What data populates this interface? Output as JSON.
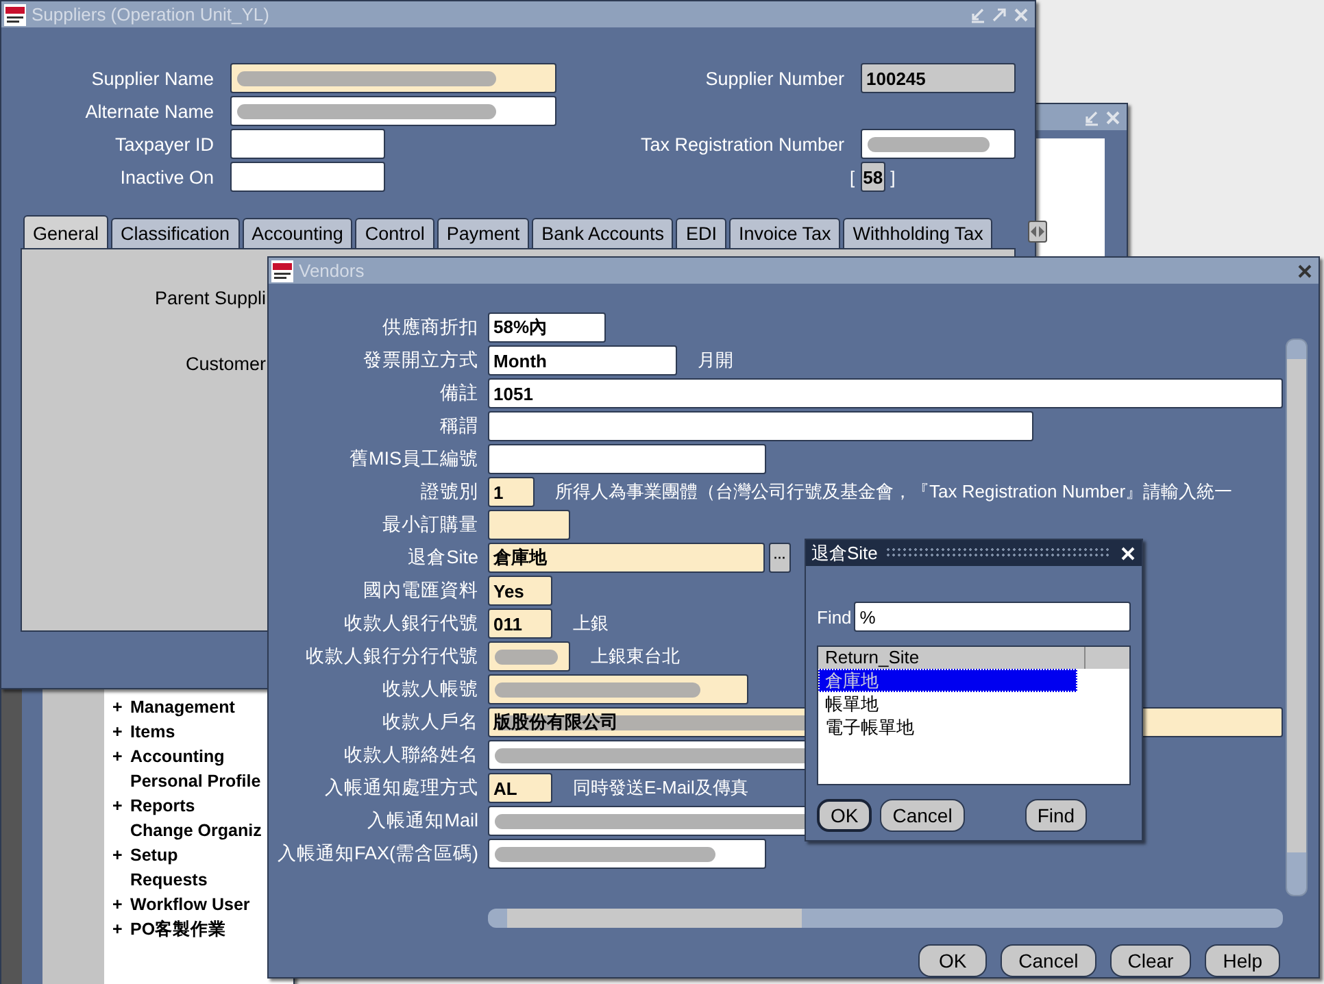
{
  "background_window": {
    "kind": "window"
  },
  "navigator": {
    "items": [
      {
        "expander": "+",
        "label": "Management"
      },
      {
        "expander": "+",
        "label": "Items"
      },
      {
        "expander": "+",
        "label": "Accounting"
      },
      {
        "label": "Personal Profile"
      },
      {
        "expander": "+",
        "label": "Reports"
      },
      {
        "label": "Change Organiz"
      },
      {
        "expander": "+",
        "label": "Setup"
      },
      {
        "label": "Requests"
      },
      {
        "expander": "+",
        "label": "Workflow User"
      },
      {
        "expander": "+",
        "label": "PO客製作業"
      }
    ]
  },
  "suppliers_window": {
    "title": "Suppliers (Operation Unit_YL)",
    "left_fields": [
      {
        "label": "Supplier Name",
        "required": true,
        "redacted": true
      },
      {
        "label": "Alternate Name",
        "required": false,
        "redacted": true
      },
      {
        "label": "Taxpayer ID",
        "required": false,
        "redacted": false
      },
      {
        "label": "Inactive On",
        "required": false,
        "redacted": false
      }
    ],
    "supplier_number": {
      "label": "Supplier Number",
      "value": "100245"
    },
    "tax_registration": {
      "label": "Tax Registration Number",
      "redacted": true
    },
    "bracket_field": {
      "open": "[",
      "value": "58",
      "close": "]"
    },
    "tabs": [
      {
        "label": "General",
        "selected": true
      },
      {
        "label": "Classification",
        "selected": false
      },
      {
        "label": "Accounting",
        "selected": false
      },
      {
        "label": "Control",
        "selected": false
      },
      {
        "label": "Payment",
        "selected": false
      },
      {
        "label": "Bank Accounts",
        "selected": false
      },
      {
        "label": "EDI",
        "selected": false
      },
      {
        "label": "Invoice Tax",
        "selected": false
      },
      {
        "label": "Withholding Tax",
        "selected": false
      }
    ],
    "tab_fields": [
      "Parent Suppli",
      "Customer"
    ]
  },
  "vendors_window": {
    "title": "Vendors",
    "rows": [
      {
        "label": "供應商折扣",
        "value": "58%內",
        "required": false,
        "redacted": false
      },
      {
        "label": "發票開立方式",
        "value": "Month",
        "required": false,
        "redacted": false,
        "note": "月開"
      },
      {
        "label": "備註",
        "value": "1051",
        "required": false,
        "redacted": false
      },
      {
        "label": "稱謂",
        "required": false,
        "redacted": false
      },
      {
        "label": "舊MIS員工編號",
        "required": false,
        "redacted": false
      },
      {
        "label": "證號別",
        "value": "1",
        "required": true,
        "redacted": false,
        "note": "所得人為事業團體（台灣公司行號及基金會，『Tax  Registration Number』請輸入統一"
      },
      {
        "label": "最小訂購量",
        "required": true,
        "redacted": false
      },
      {
        "label": "退倉Site",
        "value": "倉庫地",
        "required": true,
        "redacted": false,
        "lov_button": "···"
      },
      {
        "label": "國內電匯資料",
        "value": "Yes",
        "required": true,
        "redacted": false
      },
      {
        "label": "收款人銀行代號",
        "value": "011",
        "required": true,
        "redacted": false,
        "note": "上銀"
      },
      {
        "label": "收款人銀行分行代號",
        "required": true,
        "redacted": true,
        "note": "上銀東台北"
      },
      {
        "label": "收款人帳號",
        "required": true,
        "redacted": true
      },
      {
        "label": "收款人戶名",
        "value": "版股份有限公司",
        "required": true,
        "redacted": true
      },
      {
        "label": "收款人聯絡姓名",
        "required": false,
        "redacted": true
      },
      {
        "label": "入帳通知處理方式",
        "value": "AL",
        "required": true,
        "redacted": false,
        "note": "同時發送E-Mail及傳真"
      },
      {
        "label": "入帳通知Mail",
        "required": false,
        "redacted": true
      },
      {
        "label": "入帳通知FAX(需含區碼)",
        "required": false,
        "redacted": true
      }
    ],
    "buttons": [
      "OK",
      "Cancel",
      "Clear",
      "Help"
    ]
  },
  "site_dialog": {
    "title": "退倉Site",
    "find_label": "Find",
    "find_value": "%",
    "column": "Return_Site",
    "items": [
      {
        "label": "倉庫地",
        "selected": true
      },
      {
        "label": "帳單地",
        "selected": false
      },
      {
        "label": "電子帳單地",
        "selected": false
      }
    ],
    "buttons": [
      {
        "label": "OK",
        "default": true
      },
      {
        "label": "Cancel",
        "default": false
      },
      {
        "label": "Find",
        "default": false
      }
    ]
  }
}
